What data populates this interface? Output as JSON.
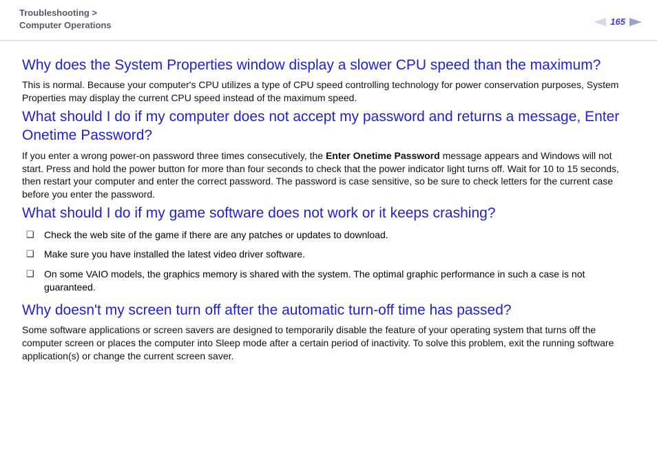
{
  "header": {
    "breadcrumb_line1": "Troubleshooting >",
    "breadcrumb_line2": "Computer Operations",
    "page_number": "165"
  },
  "sections": [
    {
      "heading": "Why does the System Properties window display a slower CPU speed than the maximum?",
      "body": "This is normal. Because your computer's CPU utilizes a type of CPU speed controlling technology for power conservation purposes, System Properties may display the current CPU speed instead of the maximum speed."
    },
    {
      "heading": "What should I do if my computer does not accept my password and returns a message, Enter Onetime Password?",
      "body_pre": "If you enter a wrong power-on password three times consecutively, the ",
      "body_bold": "Enter Onetime Password",
      "body_post": " message appears and Windows will not start. Press and hold the power button for more than four seconds to check that the power indicator light turns off. Wait for 10 to 15 seconds, then restart your computer and enter the correct password. The password is case sensitive, so be sure to check letters for the current case before you enter the password."
    },
    {
      "heading": "What should I do if my game software does not work or it keeps crashing?",
      "bullets": [
        "Check the web site of the game if there are any patches or updates to download.",
        "Make sure you have installed the latest video driver software.",
        "On some VAIO models, the graphics memory is shared with the system. The optimal graphic performance in such a case is not guaranteed."
      ]
    },
    {
      "heading": "Why doesn't my screen turn off after the automatic turn-off time has passed?",
      "body": "Some software applications or screen savers are designed to temporarily disable the feature of your operating system that turns off the computer screen or places the computer into Sleep mode after a certain period of inactivity. To solve this problem, exit the running software application(s) or change the current screen saver."
    }
  ]
}
